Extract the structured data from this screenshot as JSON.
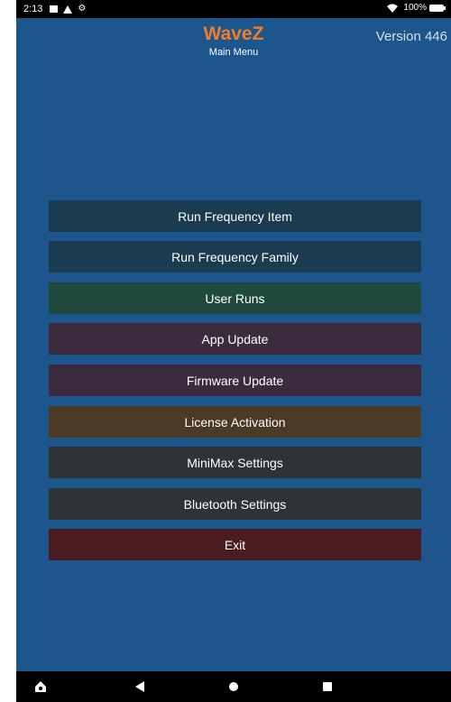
{
  "status_bar": {
    "time": "2:13",
    "battery": "100%",
    "icons": [
      "message-icon",
      "warning-icon",
      "settings-icon",
      "wifi-icon",
      "battery-icon"
    ]
  },
  "header": {
    "app_name": "WaveZ",
    "subtitle": "Main Menu",
    "version": "Version 446"
  },
  "menu": {
    "items": [
      {
        "label": "Run Frequency Item",
        "color": "#1a3b50"
      },
      {
        "label": "Run Frequency Family",
        "color": "#1a3b50"
      },
      {
        "label": "User Runs",
        "color": "#214a3f"
      },
      {
        "label": "App Update",
        "color": "#3c2a3f"
      },
      {
        "label": "Firmware Update",
        "color": "#3c2a3f"
      },
      {
        "label": "License Activation",
        "color": "#4a3a26"
      },
      {
        "label": "MiniMax Settings",
        "color": "#2e3335"
      },
      {
        "label": "Bluetooth Settings",
        "color": "#2e3335"
      },
      {
        "label": "Exit",
        "color": "#4a1b20"
      }
    ]
  },
  "colors": {
    "background": "#1c568c",
    "title": "#f07d28",
    "status_bar": "#000000"
  },
  "nav_bar": {
    "icons": [
      "assistant-icon",
      "back-icon",
      "home-icon",
      "recents-icon"
    ]
  }
}
